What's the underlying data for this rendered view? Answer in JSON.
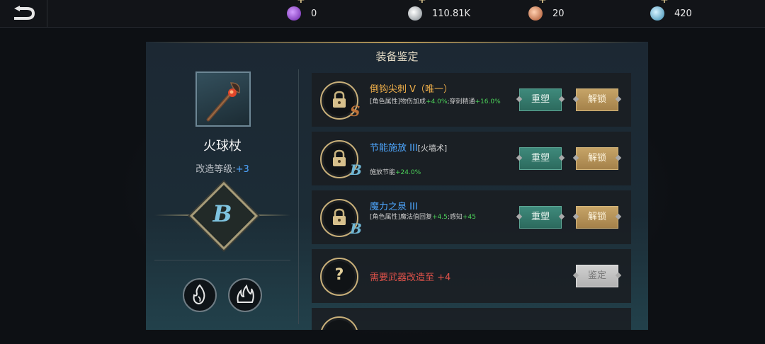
{
  "topbar": {
    "currencies": [
      {
        "icon": "purple-gem-icon",
        "value": "0",
        "color": "#9b4ed6"
      },
      {
        "icon": "silver-coin-icon",
        "value": "110.81K",
        "color": "#c6ccd2"
      },
      {
        "icon": "copper-coin-icon",
        "value": "20",
        "color": "#d9845a"
      },
      {
        "icon": "blue-crystal-icon",
        "value": "420",
        "color": "#6ec2e6"
      }
    ]
  },
  "panel": {
    "title": "装备鉴定"
  },
  "weapon": {
    "name": "火球杖",
    "level_label": "改造等级:",
    "level_value": "+3",
    "grade": "B"
  },
  "rows": [
    {
      "title": "倒钩尖刺 V（唯一）",
      "title_color": "#f1b04a",
      "sub": "",
      "desc_a": "[角色属性]物伤加成",
      "bonus_a": "+4.0%",
      "desc_b": ";穿刺精通",
      "bonus_b": "+16.0%",
      "grade": "S",
      "grade_color": "#c0743a",
      "reforge": "重塑",
      "unlock": "解锁"
    },
    {
      "title": "节能施放 III",
      "title_color": "#4ea7ff",
      "sub": "[火墙术]",
      "desc_a": "施放节能",
      "bonus_a": "+24.0%",
      "desc_b": "",
      "bonus_b": "",
      "grade": "B",
      "grade_color": "#6fb6d4",
      "reforge": "重塑",
      "unlock": "解锁"
    },
    {
      "title": "魔力之泉 III",
      "title_color": "#4ea7ff",
      "sub": "",
      "desc_a": "[角色属性]魔法值回复",
      "bonus_a": "+4.5",
      "desc_b": ";感知",
      "bonus_b": "+45",
      "grade": "B",
      "grade_color": "#6fb6d4",
      "reforge": "重塑",
      "unlock": "解锁"
    }
  ],
  "locked_row": {
    "text": "需要武器改造至 +4",
    "button": "鉴定",
    "icon_glyph": "?"
  }
}
